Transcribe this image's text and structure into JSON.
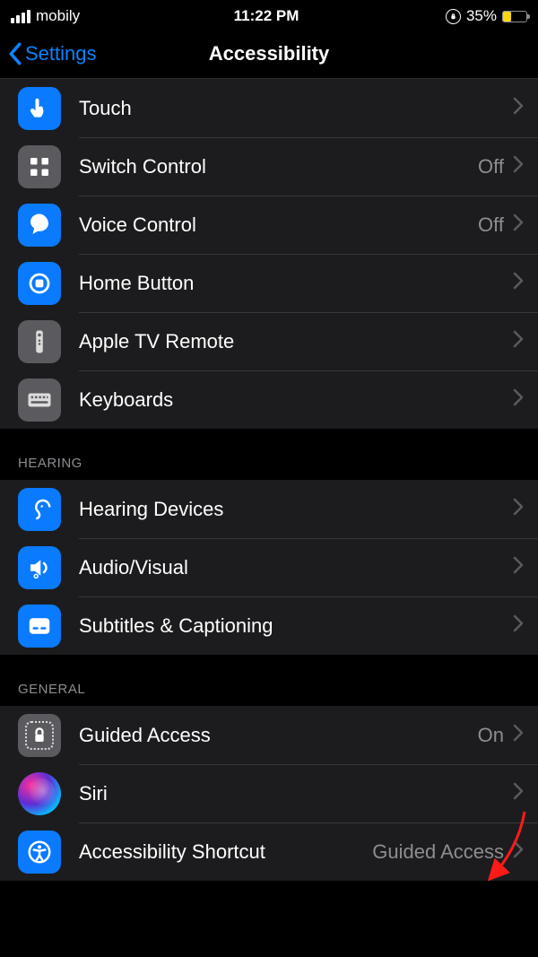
{
  "status": {
    "carrier": "mobily",
    "time": "11:22 PM",
    "battery_pct": "35%"
  },
  "nav": {
    "back_label": "Settings",
    "title": "Accessibility"
  },
  "values": {
    "off": "Off",
    "on": "On",
    "guided_access": "Guided Access"
  },
  "groups": {
    "hearing_header": "HEARING",
    "general_header": "GENERAL"
  },
  "rows": {
    "touch": "Touch",
    "switch_control": "Switch Control",
    "voice_control": "Voice Control",
    "home_button": "Home Button",
    "apple_tv_remote": "Apple TV Remote",
    "keyboards": "Keyboards",
    "hearing_devices": "Hearing Devices",
    "audio_visual": "Audio/Visual",
    "subtitles": "Subtitles & Captioning",
    "guided_access": "Guided Access",
    "siri": "Siri",
    "accessibility_shortcut": "Accessibility Shortcut"
  }
}
